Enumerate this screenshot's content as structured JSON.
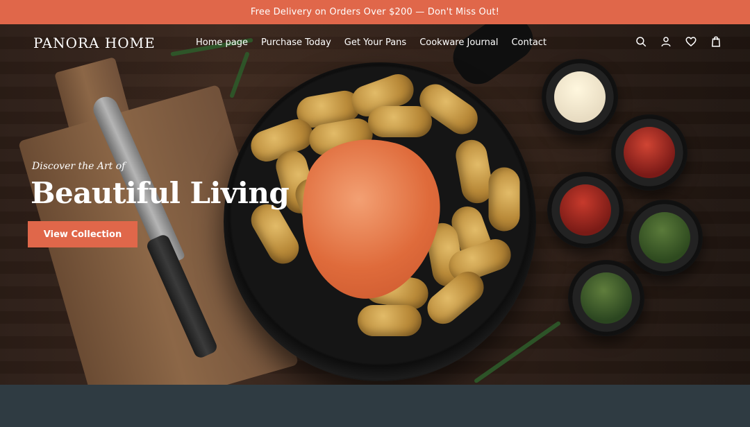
{
  "announcement": {
    "text": "Free Delivery on Orders Over $200 — Don't Miss Out!"
  },
  "header": {
    "brand": "PANORA HOME",
    "nav": [
      {
        "label": "Home page"
      },
      {
        "label": "Purchase Today"
      },
      {
        "label": "Get Your Pans"
      },
      {
        "label": "Cookware Journal"
      },
      {
        "label": "Contact"
      }
    ],
    "icons": [
      "search-icon",
      "account-icon",
      "wishlist-heart-icon",
      "cart-bag-icon"
    ]
  },
  "hero": {
    "eyebrow": "Discover the Art of",
    "headline": "Beautiful Living",
    "cta_label": "View Collection"
  },
  "theme": {
    "accent": "#e0674a",
    "bottom_band": "#2f3b42"
  }
}
